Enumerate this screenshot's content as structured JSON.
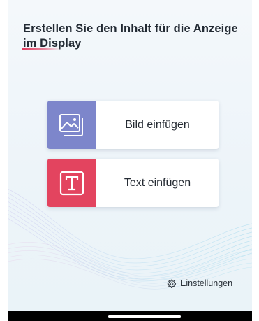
{
  "header": {
    "title": "Erstellen Sie den Inhalt für die Anzeige im Display"
  },
  "options": [
    {
      "label": "Bild einfügen",
      "icon": "image-icon",
      "accent": "#7d86cb"
    },
    {
      "label": "Text einfügen",
      "icon": "text-icon",
      "accent": "#e3445f"
    }
  ],
  "footer": {
    "settings_label": "Einstellungen",
    "settings_icon": "gear-icon"
  },
  "colors": {
    "background": "#eef5fa",
    "title": "#222a33",
    "underline": "#e0395c",
    "navbar": "#000000"
  }
}
